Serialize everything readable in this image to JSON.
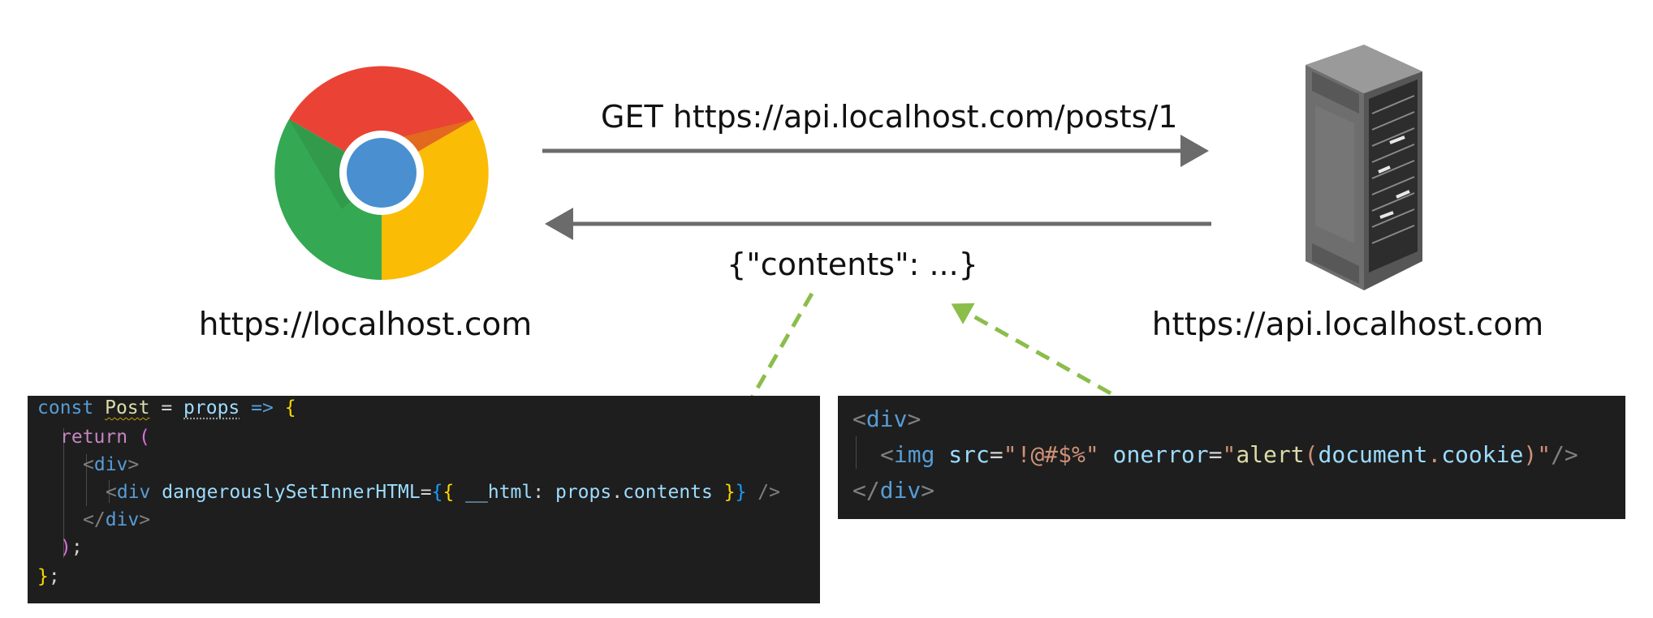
{
  "request": {
    "label": "GET https://api.localhost.com/posts/1"
  },
  "response": {
    "label": "{\"contents\": ...}"
  },
  "client": {
    "icon": "chrome-browser-icon",
    "label": "https://localhost.com"
  },
  "server": {
    "icon": "server-rack-icon",
    "label": "https://api.localhost.com"
  },
  "colors": {
    "arrow": "#6b6b6b",
    "dashed_arrow": "#8bbd4b",
    "code_bg": "#1e1e1e"
  },
  "react_code": {
    "l1": {
      "kw": "const",
      "name": "Post",
      "eq": " = ",
      "param": "props",
      "arrow": " => ",
      "brace": "{"
    },
    "l2": {
      "kw": "return",
      "paren": " ("
    },
    "l3": {
      "open": "<",
      "tag": "div",
      "close": ">"
    },
    "l4": {
      "open": "<",
      "tag": "div",
      "attr": " dangerouslySetInnerHTML",
      "eq": "=",
      "b_open": "{",
      "inner_open": "{ ",
      "key": "__html",
      "colon": ": ",
      "obj": "props",
      "dot": ".",
      "prop": "contents",
      "inner_close": " }",
      "b_close": "}",
      "self_close": " />"
    },
    "l5": {
      "open": "</",
      "tag": "div",
      "close": ">"
    },
    "l6": {
      "paren": ")",
      "semi": ";"
    },
    "l7": {
      "brace": "}",
      "semi": ";"
    }
  },
  "payload_code": {
    "l1": {
      "open": "<",
      "tag": "div",
      "close": ">"
    },
    "l2": {
      "open": "<",
      "tag": "img",
      "attr1": " src",
      "eq1": "=",
      "val1": "\"!@#$%\"",
      "attr2": " onerror",
      "eq2": "=",
      "q_open": "\"",
      "fn": "alert",
      "p_open": "(",
      "obj": "document",
      "dot": ".",
      "prop": "cookie",
      "p_close": ")",
      "q_close": "\"",
      "close": "/>"
    },
    "l3": {
      "open": "</",
      "tag": "div",
      "close": ">"
    }
  }
}
